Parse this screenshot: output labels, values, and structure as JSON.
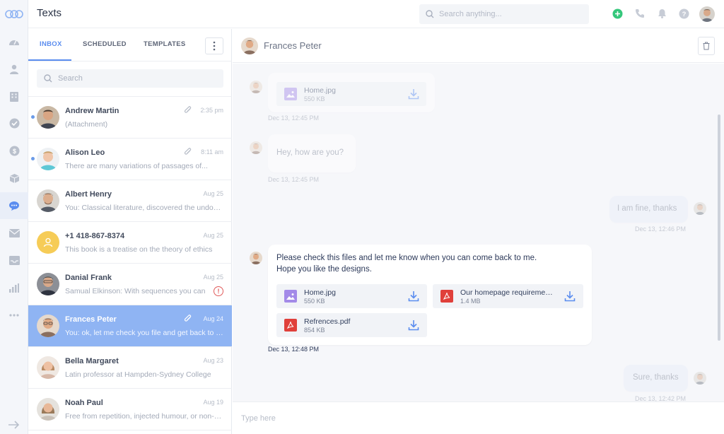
{
  "app": {
    "title": "Texts"
  },
  "header": {
    "search_placeholder": "Search anything..."
  },
  "rail": {
    "items": [
      "logo-icon",
      "dashboard-icon",
      "user-icon",
      "building-icon",
      "check-circle-icon",
      "dollar-icon",
      "box-icon",
      "chat-icon",
      "mail-icon",
      "inbox-icon",
      "bar-chart-icon",
      "more-icon",
      "arrow-right-icon"
    ],
    "active": "chat-icon"
  },
  "tabs": [
    {
      "label": "INBOX",
      "active": true
    },
    {
      "label": "SCHEDULED",
      "active": false
    },
    {
      "label": "TEMPLATES",
      "active": false
    }
  ],
  "list_search": {
    "placeholder": "Search"
  },
  "conversations": [
    {
      "name": "Andrew Martin",
      "preview": "(Attachment)",
      "time": "2:35 pm",
      "unread": true,
      "attachment": true
    },
    {
      "name": "Alison Leo",
      "preview": "There are many variations of passages of...",
      "time": "8:11 am",
      "unread": true,
      "attachment": true
    },
    {
      "name": "Albert Henry",
      "preview": "You: Classical literature, discovered the undoubtable source",
      "time": "Aug 25"
    },
    {
      "name": "+1 418-867-8374",
      "preview": "This book is a treatise on the theory of ethics",
      "time": "Aug 25"
    },
    {
      "name": "Danial Frank",
      "preview": "Samual Elkinson: With sequences you can",
      "time": "Aug 25",
      "error": "!"
    },
    {
      "name": "Frances Peter",
      "preview": "You: ok, let me check you file and get back to you",
      "time": "Aug 24",
      "attachment": true,
      "selected": true
    },
    {
      "name": "Bella Margaret",
      "preview": "Latin professor at Hampden-Sydney College",
      "time": "Aug 23"
    },
    {
      "name": "Noah Paul",
      "preview": "Free from repetition, injected humour, or non-characteristic words",
      "time": "Aug 19"
    }
  ],
  "chat": {
    "title": "Frances Peter",
    "composer_placeholder": "Type here",
    "messages": {
      "m1": {
        "file": {
          "name": "Home.jpg",
          "size": "550 KB"
        },
        "time": "Dec 13, 12:45 PM"
      },
      "m2": {
        "text": "Hey, how are you?",
        "time": "Dec 13, 12:45 PM"
      },
      "m3": {
        "text": "I am fine, thanks",
        "time": "Dec 13, 12:46 PM"
      },
      "m4": {
        "line1": "Please check this files and let me know when you can come back to me.",
        "line2": "Hope you like the designs.",
        "files": [
          {
            "name": "Home.jpg",
            "size": "550 KB"
          },
          {
            "name": "Our homepage requirements.pdf",
            "size": "1.4 MB"
          },
          {
            "name": "Refrences.pdf",
            "size": "854 KB"
          }
        ],
        "time": "Dec 13, 12:48 PM"
      },
      "m5": {
        "text": "Sure, thanks",
        "time": "Dec 13, 12:42 PM"
      }
    }
  },
  "colors": {
    "accent": "#5b8def",
    "selected_row": "#8fb4f3",
    "pdf": "#e0403b",
    "image": "#a38ae8",
    "online": "#34c77b"
  }
}
